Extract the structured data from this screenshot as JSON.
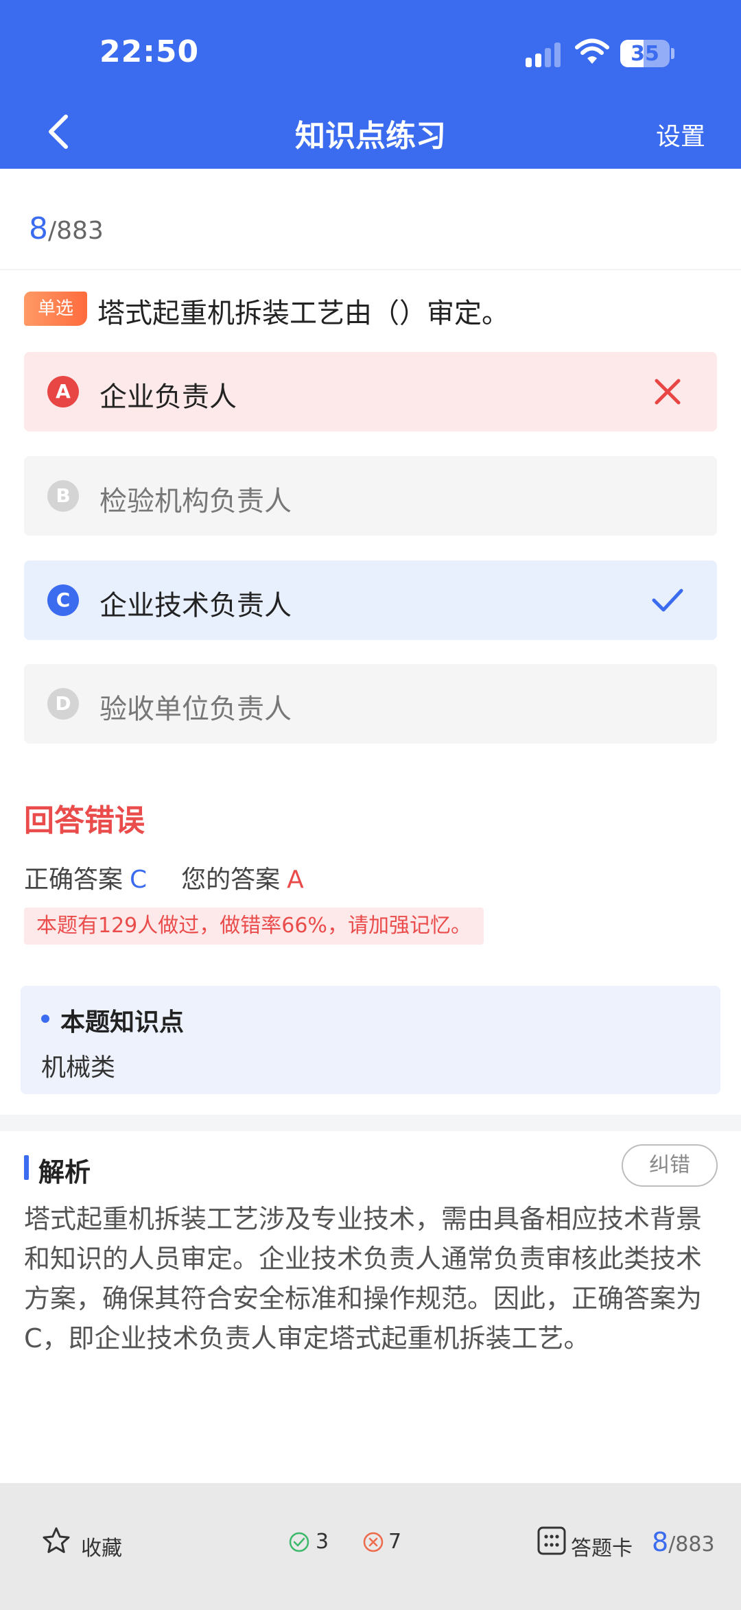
{
  "status_bar": {
    "time": "22:50",
    "battery": "35"
  },
  "nav": {
    "title": "知识点练习",
    "settings": "设置"
  },
  "progress": {
    "current": "8",
    "total": "/883"
  },
  "question": {
    "type": "单选",
    "text": "塔式起重机拆装工艺由（）审定。",
    "options": [
      {
        "letter": "A",
        "text": "企业负责人",
        "state": "wrong"
      },
      {
        "letter": "B",
        "text": "检验机构负责人",
        "state": "neutral"
      },
      {
        "letter": "C",
        "text": "企业技术负责人",
        "state": "correct"
      },
      {
        "letter": "D",
        "text": "验收单位负责人",
        "state": "neutral"
      }
    ]
  },
  "result": {
    "title": "回答错误",
    "correct_label": "正确答案",
    "correct_value": "C",
    "your_label": "您的答案",
    "your_value": "A",
    "stat": "本题有129人做过，做错率66%，请加强记忆。"
  },
  "knowledge": {
    "title": "本题知识点",
    "value": "机械类"
  },
  "analysis": {
    "title": "解析",
    "report_button": "纠错",
    "text": "塔式起重机拆装工艺涉及专业技术，需由具备相应技术背景和知识的人员审定。企业技术负责人通常负责审核此类技术方案，确保其符合安全标准和操作规范。因此，正确答案为C，即企业技术负责人审定塔式起重机拆装工艺。"
  },
  "footer": {
    "favorite": "收藏",
    "correct_count": "3",
    "wrong_count": "7",
    "answer_card": "答题卡",
    "current": "8",
    "total": "/883"
  },
  "colors": {
    "primary": "#3b6cf0",
    "error": "#ea4b4b"
  }
}
